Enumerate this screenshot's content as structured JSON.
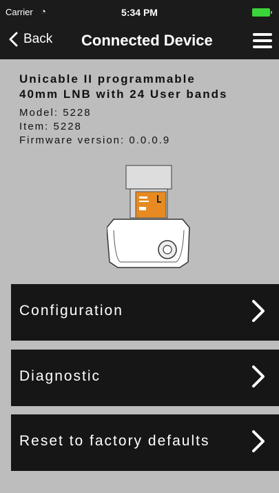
{
  "status": {
    "carrier": "Carrier",
    "wifi": "wifi-icon",
    "time": "5:34 PM",
    "battery": "battery-icon",
    "battery_color": "#3ad53a"
  },
  "nav": {
    "back_label": "Back",
    "title": "Connected Device",
    "back_icon": "chevron-left-icon",
    "menu_icon": "hamburger-menu-icon"
  },
  "device": {
    "name_line1": "Unicable II programmable",
    "name_line2": "40mm LNB with 24 User bands",
    "model": "Model: 5228",
    "item": "Item: 5228",
    "firmware": "Firmware version: 0.0.0.9",
    "label_color": "#e78a22"
  },
  "menu_items": [
    {
      "label": "Configuration",
      "icon": "chevron-right-icon"
    },
    {
      "label": "Diagnostic",
      "icon": "chevron-right-icon"
    },
    {
      "label": "Reset to factory defaults",
      "icon": "chevron-right-icon"
    }
  ]
}
